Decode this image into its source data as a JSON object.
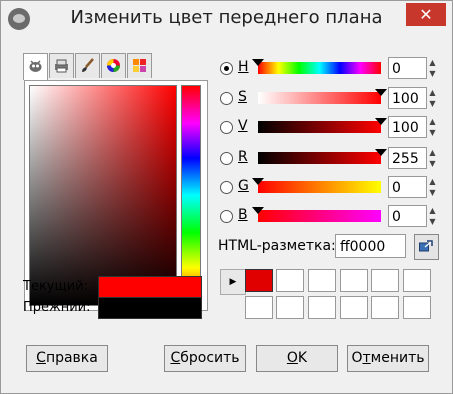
{
  "window": {
    "title": "Изменить цвет переднего плана",
    "close_symbol": "✕"
  },
  "tabs": [
    {
      "name": "gimp-selector",
      "icon": "wilber-icon",
      "active": true
    },
    {
      "name": "cmyk-selector",
      "icon": "printer-icon",
      "active": false
    },
    {
      "name": "watercolor-selector",
      "icon": "brush-icon",
      "active": false
    },
    {
      "name": "wheel-selector",
      "icon": "color-wheel-icon",
      "active": false
    },
    {
      "name": "palette-selector",
      "icon": "palette-icon",
      "active": false
    }
  ],
  "current_label": "Текущий:",
  "previous_label": "Прежний:",
  "current_color": "#ff0000",
  "previous_color": "#000000",
  "channels": [
    {
      "key": "h",
      "label": "H",
      "value": "0",
      "checked": true,
      "marker": 0.0
    },
    {
      "key": "s",
      "label": "S",
      "value": "100",
      "checked": false,
      "marker": 1.0
    },
    {
      "key": "v",
      "label": "V",
      "value": "100",
      "checked": false,
      "marker": 1.0
    },
    {
      "key": "r",
      "label": "R",
      "value": "255",
      "checked": false,
      "marker": 1.0
    },
    {
      "key": "g",
      "label": "G",
      "value": "0",
      "checked": false,
      "marker": 0.0
    },
    {
      "key": "b",
      "label": "B",
      "value": "0",
      "checked": false,
      "marker": 0.0
    }
  ],
  "html_label": "HTML-разметка:",
  "html_value": "ff0000",
  "history_first_color": "#e00000",
  "buttons": {
    "help": {
      "mnemonic": "С",
      "rest": "правка"
    },
    "reset": {
      "mnemonic": "С",
      "rest": "бросить",
      "prefix": ""
    },
    "ok": {
      "mnemonic": "O",
      "rest": "K"
    },
    "cancel": {
      "prefix": "О",
      "mnemonic": "т",
      "rest": "менить"
    }
  }
}
